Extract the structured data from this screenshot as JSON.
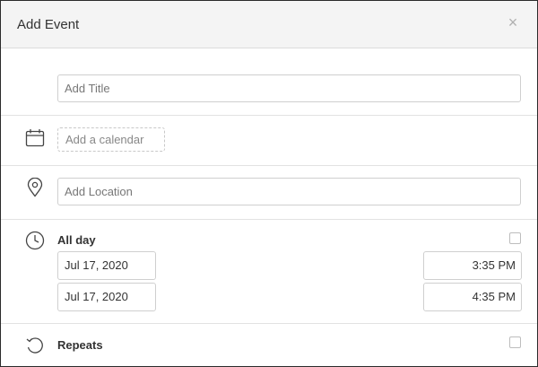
{
  "dialog": {
    "title": "Add Event",
    "close_symbol": "×"
  },
  "title_field": {
    "placeholder": "Add Title",
    "value": ""
  },
  "calendar": {
    "placeholder": "Add a calendar",
    "icon": "calendar-icon"
  },
  "location": {
    "placeholder": "Add Location",
    "value": "",
    "icon": "location-pin-icon"
  },
  "time": {
    "icon": "clock-icon",
    "all_day_label": "All day",
    "all_day_checked": false,
    "start_date": "Jul 17, 2020",
    "start_time": "3:35 PM",
    "end_date": "Jul 17, 2020",
    "end_time": "4:35 PM"
  },
  "repeats": {
    "icon": "repeat-icon",
    "label": "Repeats",
    "checked": false
  }
}
